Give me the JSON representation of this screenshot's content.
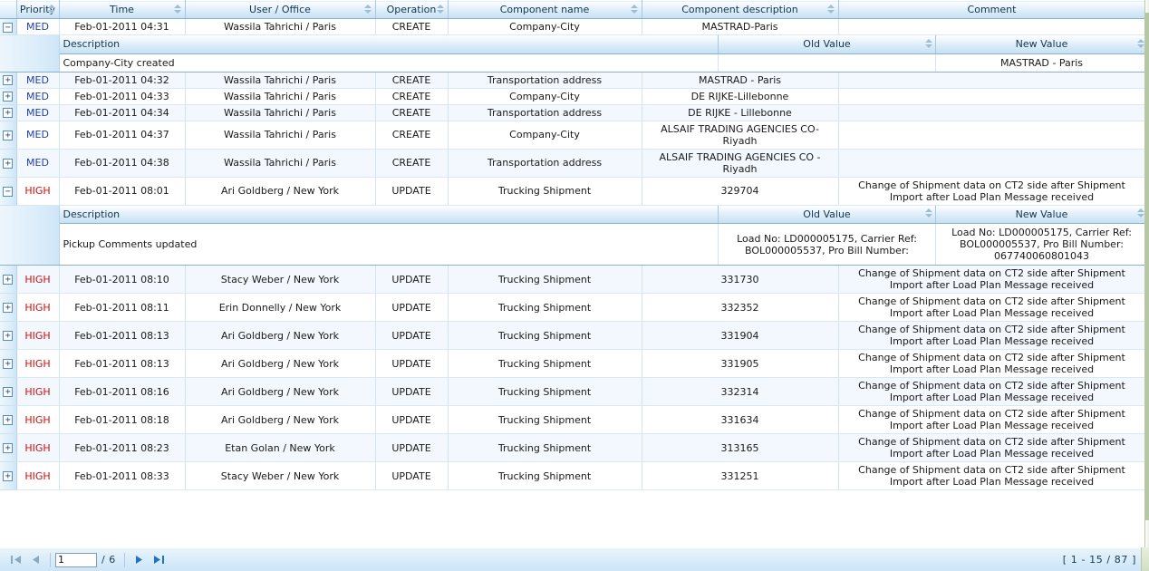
{
  "columns": [
    {
      "key": "expander",
      "label": ""
    },
    {
      "key": "priority",
      "label": "Priority",
      "sortable": true
    },
    {
      "key": "time",
      "label": "Time",
      "sortable": true
    },
    {
      "key": "user",
      "label": "User / Office",
      "sortable": true
    },
    {
      "key": "operation",
      "label": "Operation",
      "sortable": true
    },
    {
      "key": "component_name",
      "label": "Component name",
      "sortable": true
    },
    {
      "key": "component_description",
      "label": "Component description",
      "sortable": true
    },
    {
      "key": "comment",
      "label": "Comment",
      "sortable": false
    }
  ],
  "detail_columns": [
    {
      "key": "description",
      "label": "Description",
      "sortable": false
    },
    {
      "key": "old_value",
      "label": "Old Value",
      "sortable": true
    },
    {
      "key": "new_value",
      "label": "New Value",
      "sortable": true
    }
  ],
  "rows": [
    {
      "expander": "minus",
      "priority": "MED",
      "priority_level": "med",
      "time": "Feb-01-2011 04:31",
      "user": "Wassila Tahrichi / Paris",
      "operation": "CREATE",
      "component_name": "Company-City",
      "component_description": "MASTRAD-Paris",
      "comment": "",
      "expanded": true,
      "detail": {
        "description": "Company-City created",
        "old_value": "",
        "new_value": "MASTRAD - Paris"
      }
    },
    {
      "expander": "plus",
      "priority": "MED",
      "priority_level": "med",
      "time": "Feb-01-2011 04:32",
      "user": "Wassila Tahrichi / Paris",
      "operation": "CREATE",
      "component_name": "Transportation address",
      "component_description": "MASTRAD - Paris",
      "comment": "",
      "expanded": false
    },
    {
      "expander": "plus",
      "priority": "MED",
      "priority_level": "med",
      "time": "Feb-01-2011 04:33",
      "user": "Wassila Tahrichi / Paris",
      "operation": "CREATE",
      "component_name": "Company-City",
      "component_description": "DE RIJKE-Lillebonne",
      "comment": "",
      "expanded": false
    },
    {
      "expander": "plus",
      "priority": "MED",
      "priority_level": "med",
      "time": "Feb-01-2011 04:34",
      "user": "Wassila Tahrichi / Paris",
      "operation": "CREATE",
      "component_name": "Transportation address",
      "component_description": "DE RIJKE - Lillebonne",
      "comment": "",
      "expanded": false
    },
    {
      "expander": "plus",
      "priority": "MED",
      "priority_level": "med",
      "time": "Feb-01-2011 04:37",
      "user": "Wassila Tahrichi / Paris",
      "operation": "CREATE",
      "component_name": "Company-City",
      "component_description": "ALSAIF TRADING AGENCIES CO-Riyadh",
      "comment": "",
      "expanded": false
    },
    {
      "expander": "plus",
      "priority": "MED",
      "priority_level": "med",
      "time": "Feb-01-2011 04:38",
      "user": "Wassila Tahrichi / Paris",
      "operation": "CREATE",
      "component_name": "Transportation address",
      "component_description": "ALSAIF TRADING AGENCIES CO - Riyadh",
      "comment": "",
      "expanded": false
    },
    {
      "expander": "minus",
      "priority": "HIGH",
      "priority_level": "high",
      "time": "Feb-01-2011 08:01",
      "user": "Ari Goldberg / New York",
      "operation": "UPDATE",
      "component_name": "Trucking Shipment",
      "component_description": "329704",
      "comment": "Change of Shipment data on CT2 side after Shipment Import after Load Plan Message received",
      "expanded": true,
      "detail": {
        "description": "Pickup Comments updated",
        "old_value": "Load No: LD000005175, Carrier Ref: BOL000005537, Pro Bill Number:",
        "new_value": "Load No: LD000005175, Carrier Ref: BOL000005537, Pro Bill Number: 067740060801043"
      }
    },
    {
      "expander": "plus",
      "priority": "HIGH",
      "priority_level": "high",
      "time": "Feb-01-2011 08:10",
      "user": "Stacy Weber / New York",
      "operation": "UPDATE",
      "component_name": "Trucking Shipment",
      "component_description": "331730",
      "comment": "Change of Shipment data on CT2 side after Shipment Import after Load Plan Message received",
      "expanded": false
    },
    {
      "expander": "plus",
      "priority": "HIGH",
      "priority_level": "high",
      "time": "Feb-01-2011 08:11",
      "user": "Erin Donnelly / New York",
      "operation": "UPDATE",
      "component_name": "Trucking Shipment",
      "component_description": "332352",
      "comment": "Change of Shipment data on CT2 side after Shipment Import after Load Plan Message received",
      "expanded": false
    },
    {
      "expander": "plus",
      "priority": "HIGH",
      "priority_level": "high",
      "time": "Feb-01-2011 08:13",
      "user": "Ari Goldberg / New York",
      "operation": "UPDATE",
      "component_name": "Trucking Shipment",
      "component_description": "331904",
      "comment": "Change of Shipment data on CT2 side after Shipment Import after Load Plan Message received",
      "expanded": false
    },
    {
      "expander": "plus",
      "priority": "HIGH",
      "priority_level": "high",
      "time": "Feb-01-2011 08:13",
      "user": "Ari Goldberg / New York",
      "operation": "UPDATE",
      "component_name": "Trucking Shipment",
      "component_description": "331905",
      "comment": "Change of Shipment data on CT2 side after Shipment Import after Load Plan Message received",
      "expanded": false
    },
    {
      "expander": "plus",
      "priority": "HIGH",
      "priority_level": "high",
      "time": "Feb-01-2011 08:16",
      "user": "Ari Goldberg / New York",
      "operation": "UPDATE",
      "component_name": "Trucking Shipment",
      "component_description": "332314",
      "comment": "Change of Shipment data on CT2 side after Shipment Import after Load Plan Message received",
      "expanded": false
    },
    {
      "expander": "plus",
      "priority": "HIGH",
      "priority_level": "high",
      "time": "Feb-01-2011 08:18",
      "user": "Ari Goldberg / New York",
      "operation": "UPDATE",
      "component_name": "Trucking Shipment",
      "component_description": "331634",
      "comment": "Change of Shipment data on CT2 side after Shipment Import after Load Plan Message received",
      "expanded": false
    },
    {
      "expander": "plus",
      "priority": "HIGH",
      "priority_level": "high",
      "time": "Feb-01-2011 08:23",
      "user": "Etan Golan / New York",
      "operation": "UPDATE",
      "component_name": "Trucking Shipment",
      "component_description": "313165",
      "comment": "Change of Shipment data on CT2 side after Shipment Import after Load Plan Message received",
      "expanded": false
    },
    {
      "expander": "plus",
      "priority": "HIGH",
      "priority_level": "high",
      "time": "Feb-01-2011 08:33",
      "user": "Stacy Weber / New York",
      "operation": "UPDATE",
      "component_name": "Trucking Shipment",
      "component_description": "331251",
      "comment": "Change of Shipment data on CT2 side after Shipment Import after Load Plan Message received",
      "expanded": false
    }
  ],
  "pager": {
    "first_icon": "first-page-icon",
    "prev_icon": "previous-page-icon",
    "next_icon": "next-page-icon",
    "last_icon": "last-page-icon",
    "current_page": "1",
    "total_pages_label": "/ 6",
    "status": "[ 1 - 15 / 87 ]",
    "first_enabled": false,
    "prev_enabled": false,
    "next_enabled": true,
    "last_enabled": true
  },
  "colors": {
    "priority_med": "#1f3faa",
    "priority_high": "#cc1111",
    "header_accent": "#c5e1f3",
    "row_alt": "#f2f8fd"
  }
}
